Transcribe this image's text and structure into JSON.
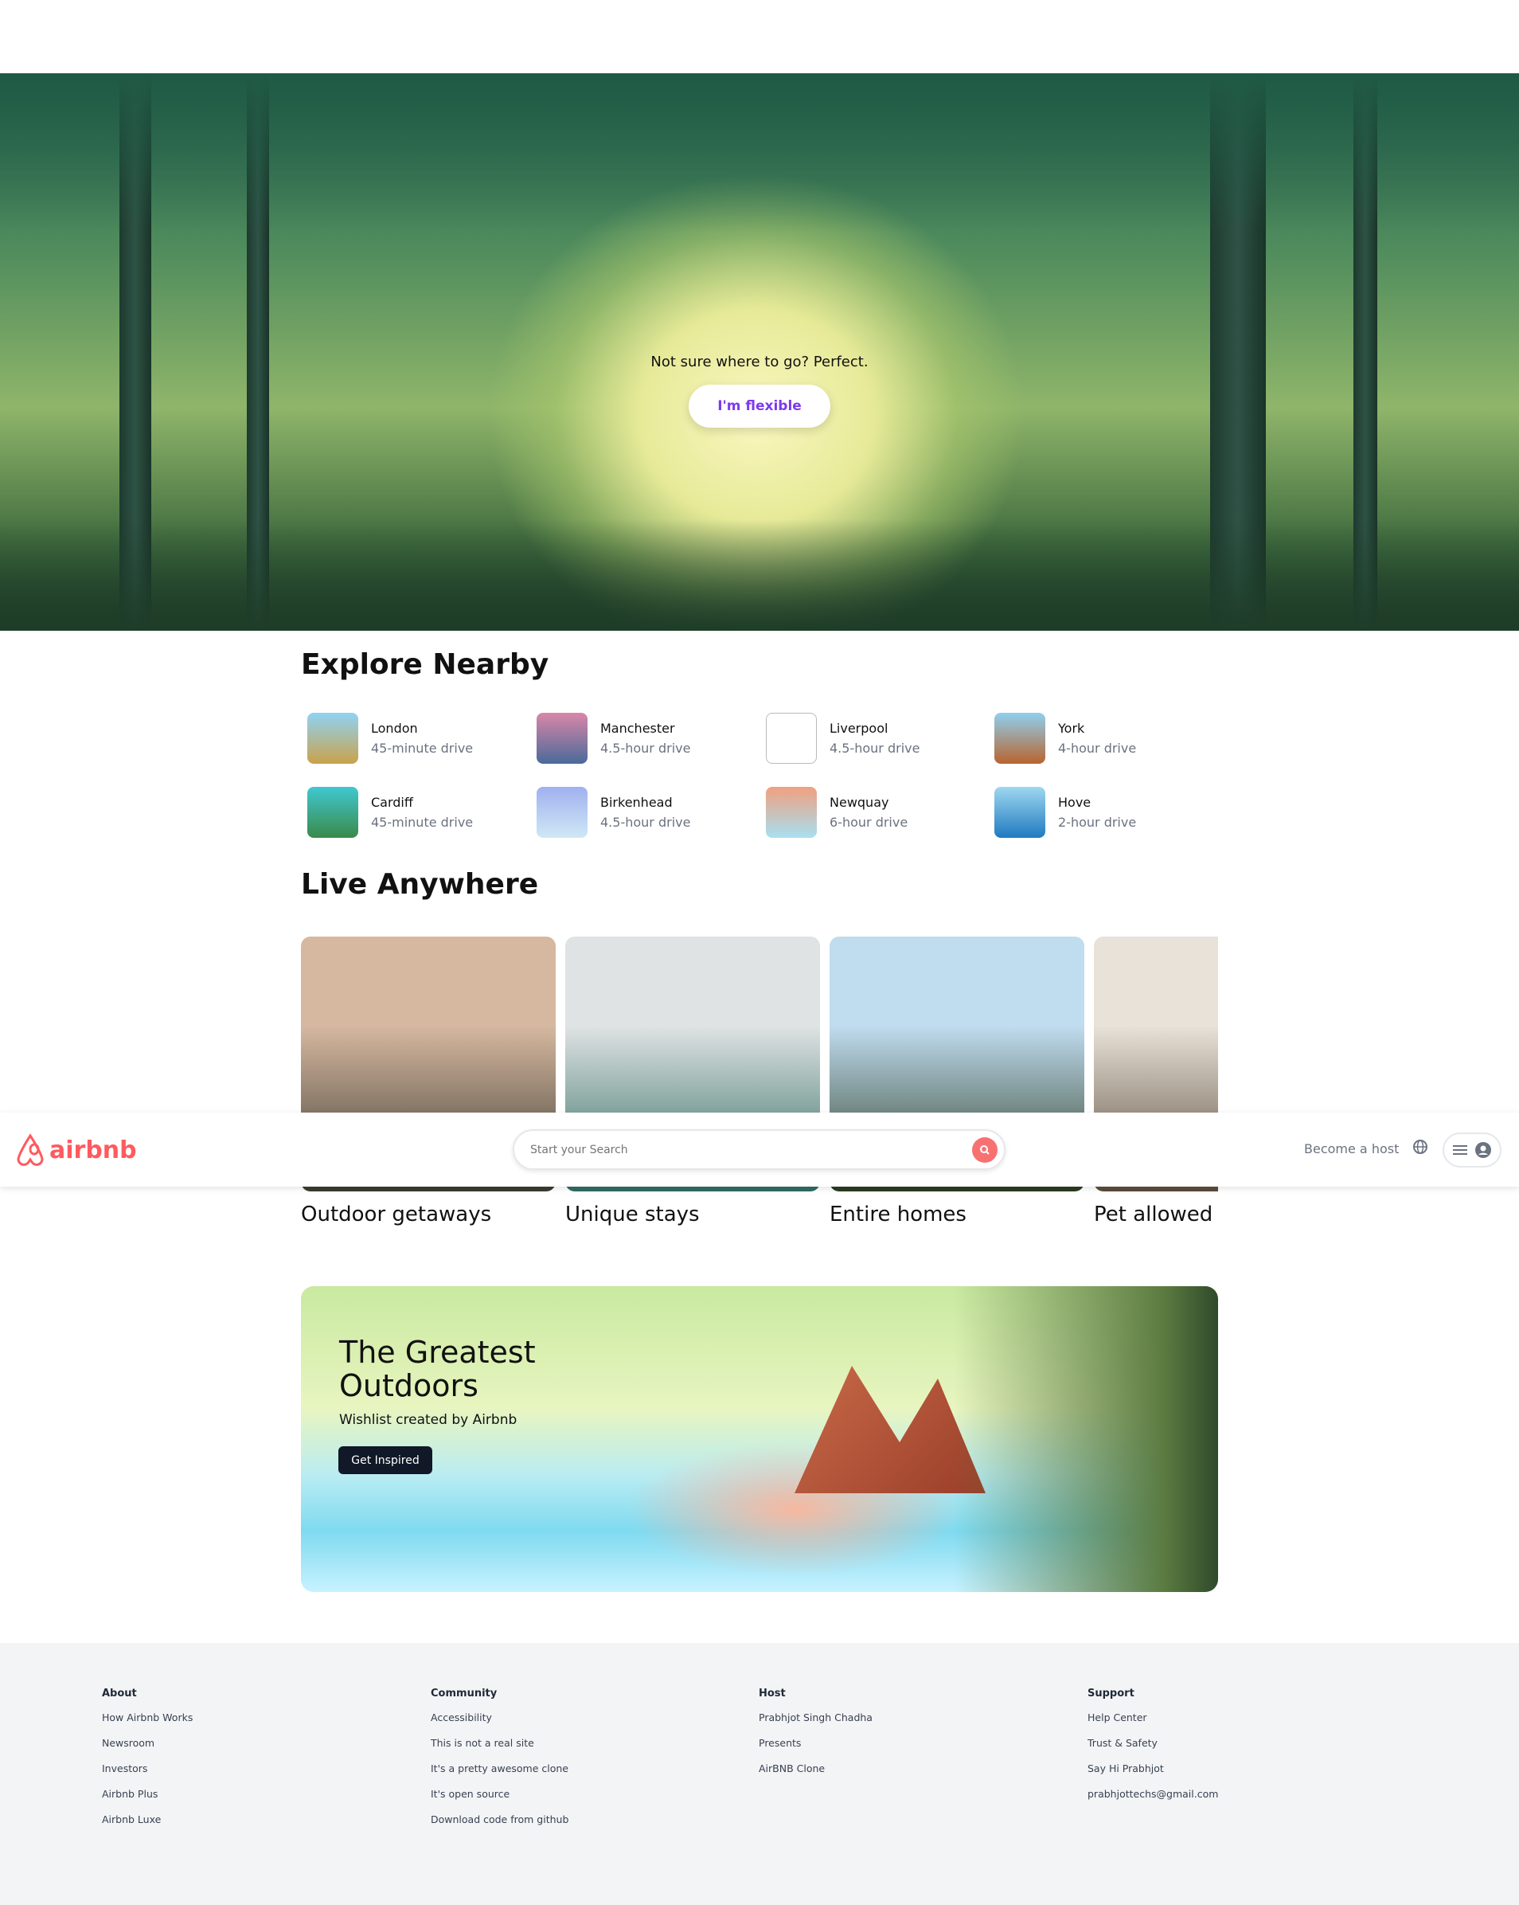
{
  "hero": {
    "tagline": "Not sure where to go? Perfect.",
    "button": "I'm flexible"
  },
  "explore": {
    "title": "Explore Nearby",
    "items": [
      {
        "name": "London",
        "distance": "45-minute drive",
        "colors": [
          "#8fd3f4",
          "#c9a24a"
        ]
      },
      {
        "name": "Manchester",
        "distance": "4.5-hour drive",
        "colors": [
          "#d987a8",
          "#4a6a9a"
        ]
      },
      {
        "name": "Liverpool",
        "distance": "4.5-hour drive",
        "colors": [
          "#ffffff",
          "#ffffff"
        ]
      },
      {
        "name": "York",
        "distance": "4-hour drive",
        "colors": [
          "#8fd0f0",
          "#b8642e"
        ]
      },
      {
        "name": "Cardiff",
        "distance": "45-minute drive",
        "colors": [
          "#40c8d0",
          "#3a8a4a"
        ]
      },
      {
        "name": "Birkenhead",
        "distance": "4.5-hour drive",
        "colors": [
          "#a0b0f0",
          "#cfe8f5"
        ]
      },
      {
        "name": "Newquay",
        "distance": "6-hour drive",
        "colors": [
          "#f0a080",
          "#a8dff0"
        ]
      },
      {
        "name": "Hove",
        "distance": "2-hour drive",
        "colors": [
          "#9fd8f0",
          "#1f7ac0"
        ]
      }
    ]
  },
  "live": {
    "title": "Live Anywhere",
    "cards": [
      {
        "label": "Outdoor getaways",
        "colors": [
          "#d6b8a0",
          "#3a3a30"
        ]
      },
      {
        "label": "Unique stays",
        "colors": [
          "#dfe3e3",
          "#2f6a60"
        ]
      },
      {
        "label": "Entire homes",
        "colors": [
          "#c0dcef",
          "#2a3a20"
        ]
      },
      {
        "label": "Pet allowed",
        "colors": [
          "#e8e2d8",
          "#5a4a3a"
        ]
      }
    ]
  },
  "header": {
    "logo": "airbnb",
    "search_placeholder": "Start your Search",
    "become_host": "Become a host"
  },
  "banner": {
    "title": "The Greatest Outdoors",
    "subtitle": "Wishlist created by Airbnb",
    "button": "Get Inspired"
  },
  "footer": {
    "columns": [
      {
        "heading": "About",
        "links": [
          "How Airbnb Works",
          "Newsroom",
          "Investors",
          "Airbnb Plus",
          "Airbnb Luxe"
        ]
      },
      {
        "heading": "Community",
        "links": [
          "Accessibility",
          "This is not a real site",
          "It's a pretty awesome clone",
          "It's open source",
          "Download code from github"
        ]
      },
      {
        "heading": "Host",
        "links": [
          "Prabhjot Singh Chadha",
          "Presents",
          "AirBNB Clone"
        ]
      },
      {
        "heading": "Support",
        "links": [
          "Help Center",
          "Trust & Safety",
          "Say Hi Prabhjot",
          "prabhjottechs@gmail.com"
        ]
      }
    ]
  },
  "colors": {
    "brand": "#ff5a5f",
    "flexible": "#7c3aed",
    "footer_bg": "#f3f4f6"
  }
}
